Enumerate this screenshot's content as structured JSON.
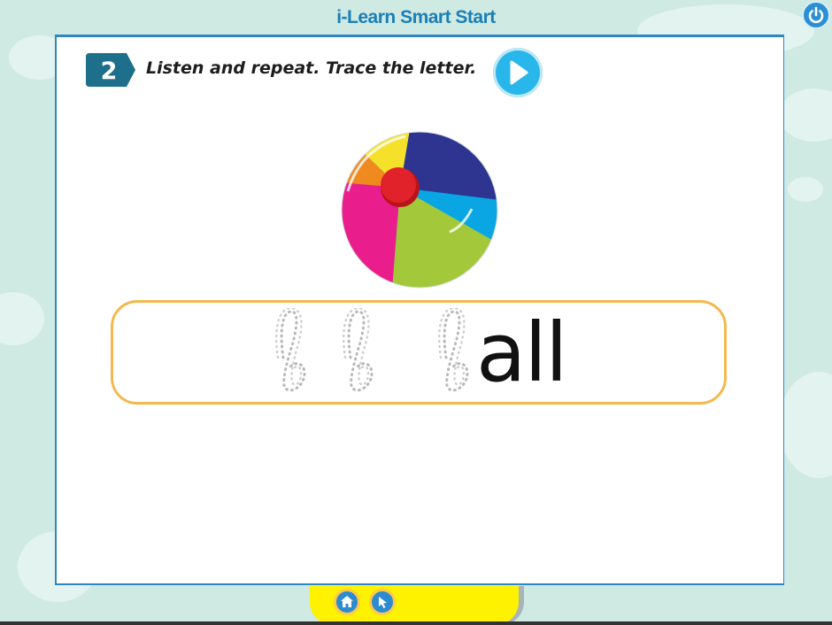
{
  "app": {
    "title": "i-Learn Smart Start"
  },
  "exercise": {
    "number": "2",
    "instruction": "Listen and repeat. Trace the letter."
  },
  "trace": {
    "traced_letter": "b",
    "word_remainder": "all"
  },
  "icons": {
    "power": "power-icon",
    "play": "play-icon",
    "home": "home-icon",
    "back": "back-icon",
    "picture": "beach-ball"
  },
  "colors": {
    "title": "#1a7fb7",
    "panel_border": "#2f86c4",
    "badge": "#1e6f8c",
    "play": "#29b6ea",
    "trace_border": "#f5b84f",
    "bottom_bar": "#fff200"
  }
}
